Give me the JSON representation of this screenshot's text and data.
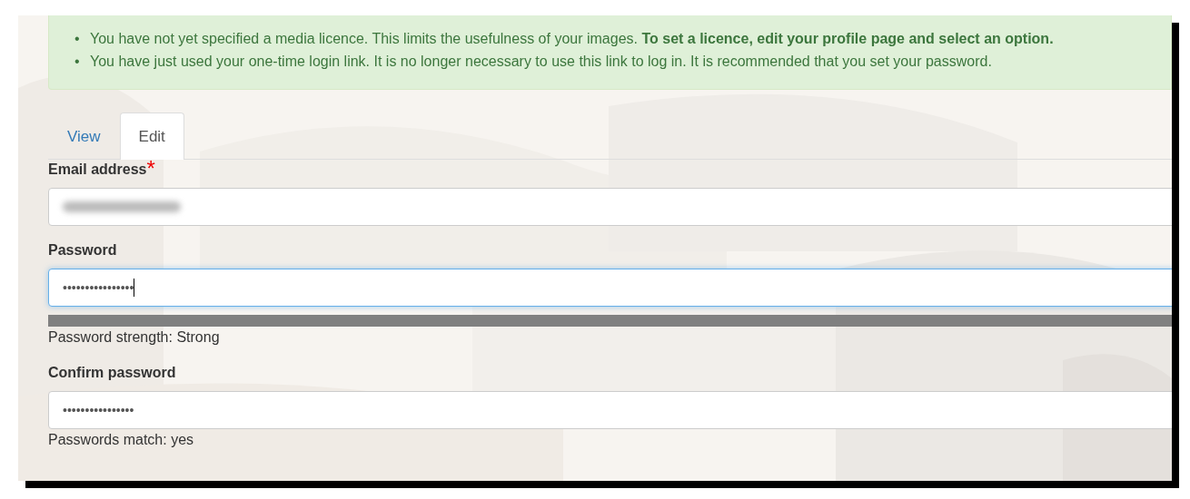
{
  "messages": [
    {
      "bullet": "•",
      "text": "You have not yet specified a media licence. This limits the usefulness of your images. **To set a licence, edit your profile page and select an option.**"
    },
    {
      "bullet": "•",
      "text": "You have just used your one-time login link. It is no longer necessary to use this link to log in. It is recommended that you set your password."
    }
  ],
  "tabs": [
    {
      "label": "View",
      "selected": false
    },
    {
      "label": "Edit",
      "selected": true
    }
  ],
  "fields": [
    {
      "label": "Email address",
      "required_mark": "*",
      "value_redacted": true,
      "focused": false
    },
    {
      "label": "Password",
      "value": "••••••••••••••••",
      "focused": true,
      "strength": {
        "level": 1,
        "text": "Password strength: Strong"
      }
    },
    {
      "label": "Confirm password",
      "value": "••••••••••••••••",
      "focused": false,
      "note": "Passwords match: yes"
    }
  ]
}
